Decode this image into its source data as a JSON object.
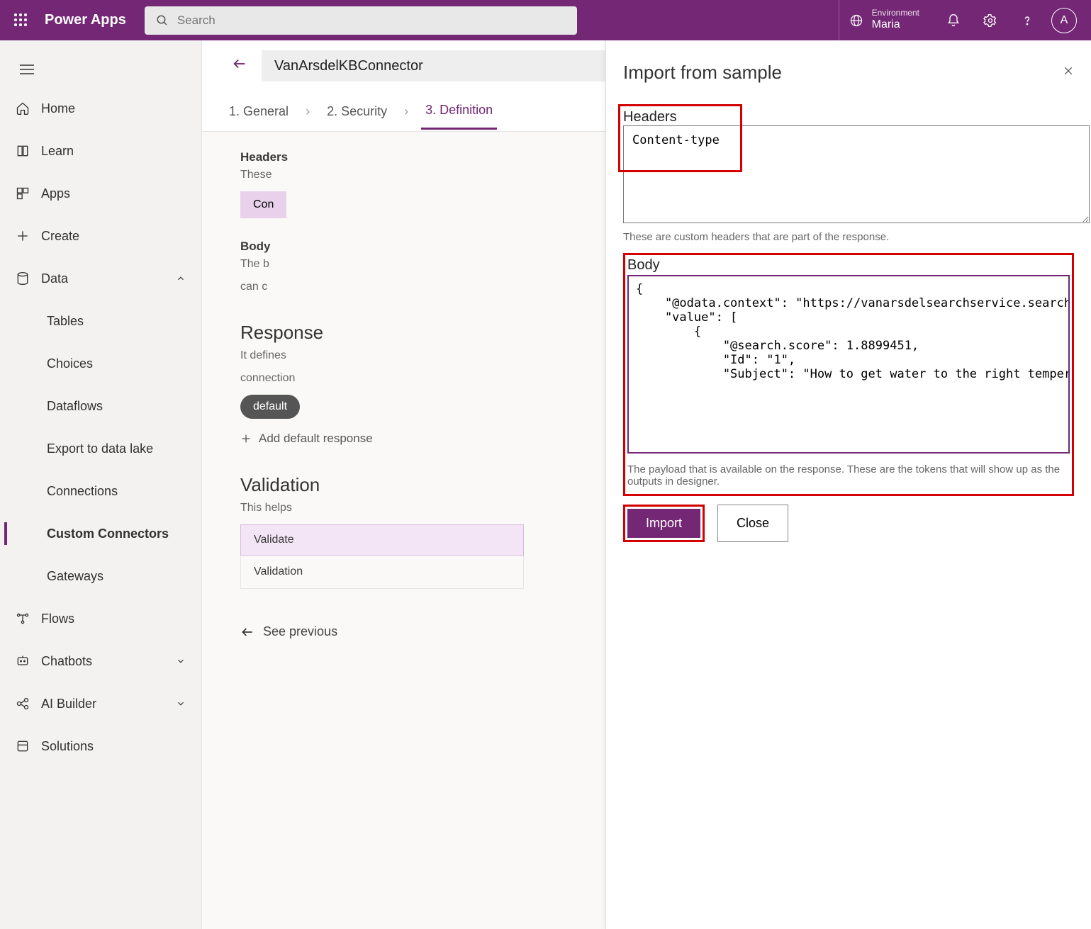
{
  "topbar": {
    "brand": "Power Apps",
    "search_placeholder": "Search",
    "env_label": "Environment",
    "env_name": "Maria",
    "avatar_letter": "A"
  },
  "sidebar": {
    "home": "Home",
    "learn": "Learn",
    "apps": "Apps",
    "create": "Create",
    "data": "Data",
    "data_children": {
      "tables": "Tables",
      "choices": "Choices",
      "dataflows": "Dataflows",
      "export": "Export to data lake",
      "connections": "Connections",
      "custom_connectors": "Custom Connectors",
      "gateways": "Gateways"
    },
    "flows": "Flows",
    "chatbots": "Chatbots",
    "ai_builder": "AI Builder",
    "solutions": "Solutions"
  },
  "page": {
    "title": "VanArsdelKBConnector",
    "steps": {
      "s1": "1. General",
      "s2": "2. Security",
      "s3": "3. Definition"
    },
    "headers_label": "Headers",
    "headers_hint": "These",
    "headers_btn": "Con",
    "body_label": "Body",
    "body_hint1": "The b",
    "body_hint2": "can c",
    "response_title": "Response",
    "response_desc1": "It defines",
    "response_desc2": "connection",
    "default_pill": "default",
    "add_default": "Add default response",
    "validation_title": "Validation",
    "validation_desc": "This helps",
    "validate_btn": "Validate",
    "validation_result": "Validation",
    "see_prev": "See previous"
  },
  "panel": {
    "title": "Import from sample",
    "headers_label": "Headers",
    "headers_value": "Content-type",
    "headers_help": "These are custom headers that are part of the response.",
    "body_label": "Body",
    "body_value": "{\n    \"@odata.context\": \"https://vanarsdelsearchservice.search.windows.net/indexes('azuresql-index')/$metadata#docs(*)\",\n    \"value\": [\n        {\n            \"@search.score\": 1.8899451,\n            \"Id\": \"1\",\n            \"Subject\": \"How to get water to the right temperature\",",
    "body_help": "The payload that is available on the response. These are the tokens that will show up as the outputs in designer.",
    "import_btn": "Import",
    "close_btn": "Close"
  }
}
